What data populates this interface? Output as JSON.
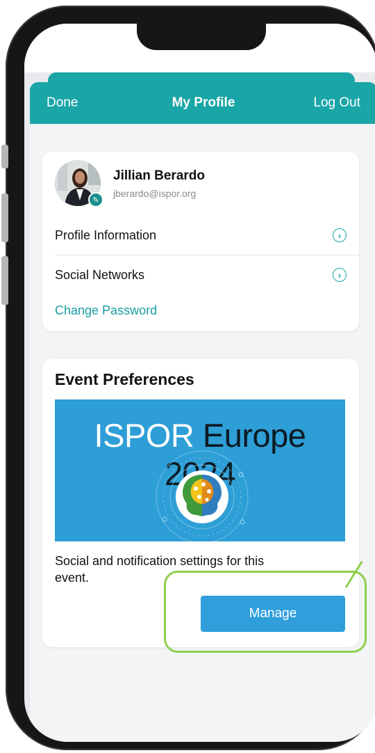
{
  "navbar": {
    "done_label": "Done",
    "title": "My Profile",
    "logout_label": "Log Out"
  },
  "profile": {
    "name": "Jillian Berardo",
    "email": "jberardo@ispor.org",
    "rows": [
      {
        "label": "Profile Information",
        "icon": "chevron-right-circle-icon"
      },
      {
        "label": "Social Networks",
        "icon": "chevron-right-circle-icon"
      }
    ],
    "change_password_label": "Change Password"
  },
  "event": {
    "section_title": "Event Preferences",
    "banner": {
      "word1": "ISPOR",
      "word2": "Europe 2024"
    },
    "description": "Social and notification settings for this event.",
    "manage_label": "Manage"
  },
  "colors": {
    "navbar": "#1aa5a7",
    "link": "#1a9ea3",
    "banner": "#2e9ed6",
    "button": "#2f9edb",
    "highlight": "#8ecf4e"
  }
}
